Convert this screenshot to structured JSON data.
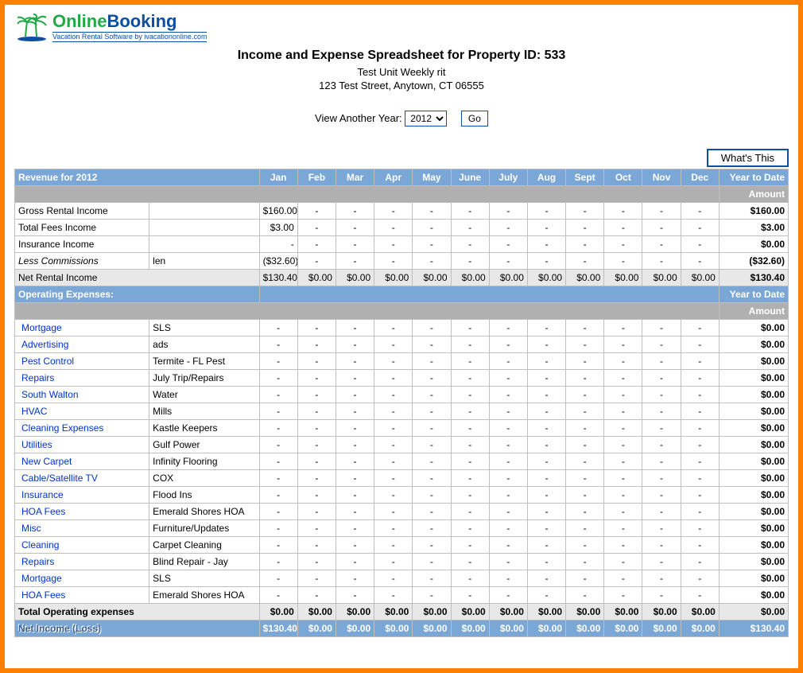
{
  "logo": {
    "word1": "Online",
    "word2": "Booking",
    "tagline": "Vacation Rental Software by ivacationonline.com"
  },
  "header": {
    "title": "Income and Expense Spreadsheet for Property ID: 533",
    "unit": "Test Unit Weekly rit",
    "address": "123 Test Street, Anytown, CT 06555"
  },
  "year_picker": {
    "label": "View Another Year:",
    "selected": "2012",
    "go": "Go"
  },
  "buttons": {
    "whats_this": "What's This"
  },
  "months": [
    "Jan",
    "Feb",
    "Mar",
    "Apr",
    "May",
    "June",
    "July",
    "Aug",
    "Sept",
    "Oct",
    "Nov",
    "Dec"
  ],
  "ytd_hdr": "Year to Date",
  "ytd_sub": "Amount",
  "revenue": {
    "section_label": "Revenue for 2012",
    "rows": [
      {
        "label": "Gross Rental Income",
        "vendor": "",
        "jan": "$160.00",
        "rest_dash": true,
        "ytd": "$160.00"
      },
      {
        "label": "Total Fees Income",
        "vendor": "",
        "jan": "$3.00",
        "rest_dash": true,
        "ytd": "$3.00"
      },
      {
        "label": "Insurance Income",
        "vendor": "",
        "jan": "-",
        "rest_dash": true,
        "ytd": "$0.00"
      },
      {
        "label": "Less Commissions",
        "vendor": "len",
        "jan": "($32.60)",
        "rest_dash": true,
        "ytd": "($32.60)",
        "italic": true
      }
    ],
    "net": {
      "label": "Net Rental Income",
      "jan": "$130.40",
      "rest": "$0.00",
      "ytd": "$130.40"
    }
  },
  "expenses": {
    "section_label": "Operating Expenses:",
    "rows": [
      {
        "label": "Mortgage",
        "vendor": "SLS"
      },
      {
        "label": "Advertising",
        "vendor": "ads"
      },
      {
        "label": "Pest Control",
        "vendor": "Termite - FL Pest"
      },
      {
        "label": "Repairs",
        "vendor": "July Trip/Repairs"
      },
      {
        "label": "South Walton",
        "vendor": "Water"
      },
      {
        "label": "HVAC",
        "vendor": "Mills"
      },
      {
        "label": "Cleaning Expenses",
        "vendor": "Kastle Keepers"
      },
      {
        "label": "Utilities",
        "vendor": "Gulf Power"
      },
      {
        "label": "New Carpet",
        "vendor": "Infinity Flooring"
      },
      {
        "label": "Cable/Satellite TV",
        "vendor": "COX"
      },
      {
        "label": "Insurance",
        "vendor": "Flood Ins"
      },
      {
        "label": "HOA Fees",
        "vendor": "Emerald Shores HOA"
      },
      {
        "label": "Misc",
        "vendor": "Furniture/Updates"
      },
      {
        "label": "Cleaning",
        "vendor": "Carpet Cleaning"
      },
      {
        "label": "Repairs",
        "vendor": "Blind Repair - Jay"
      },
      {
        "label": "Mortgage",
        "vendor": "SLS"
      },
      {
        "label": "HOA Fees",
        "vendor": "Emerald Shores HOA"
      }
    ],
    "total": {
      "label": "Total Operating expenses",
      "val": "$0.00",
      "ytd": "$0.00"
    }
  },
  "net_income": {
    "label": "Net Income (Loss)",
    "jan": "$130.40",
    "rest": "$0.00",
    "ytd": "$130.40"
  }
}
